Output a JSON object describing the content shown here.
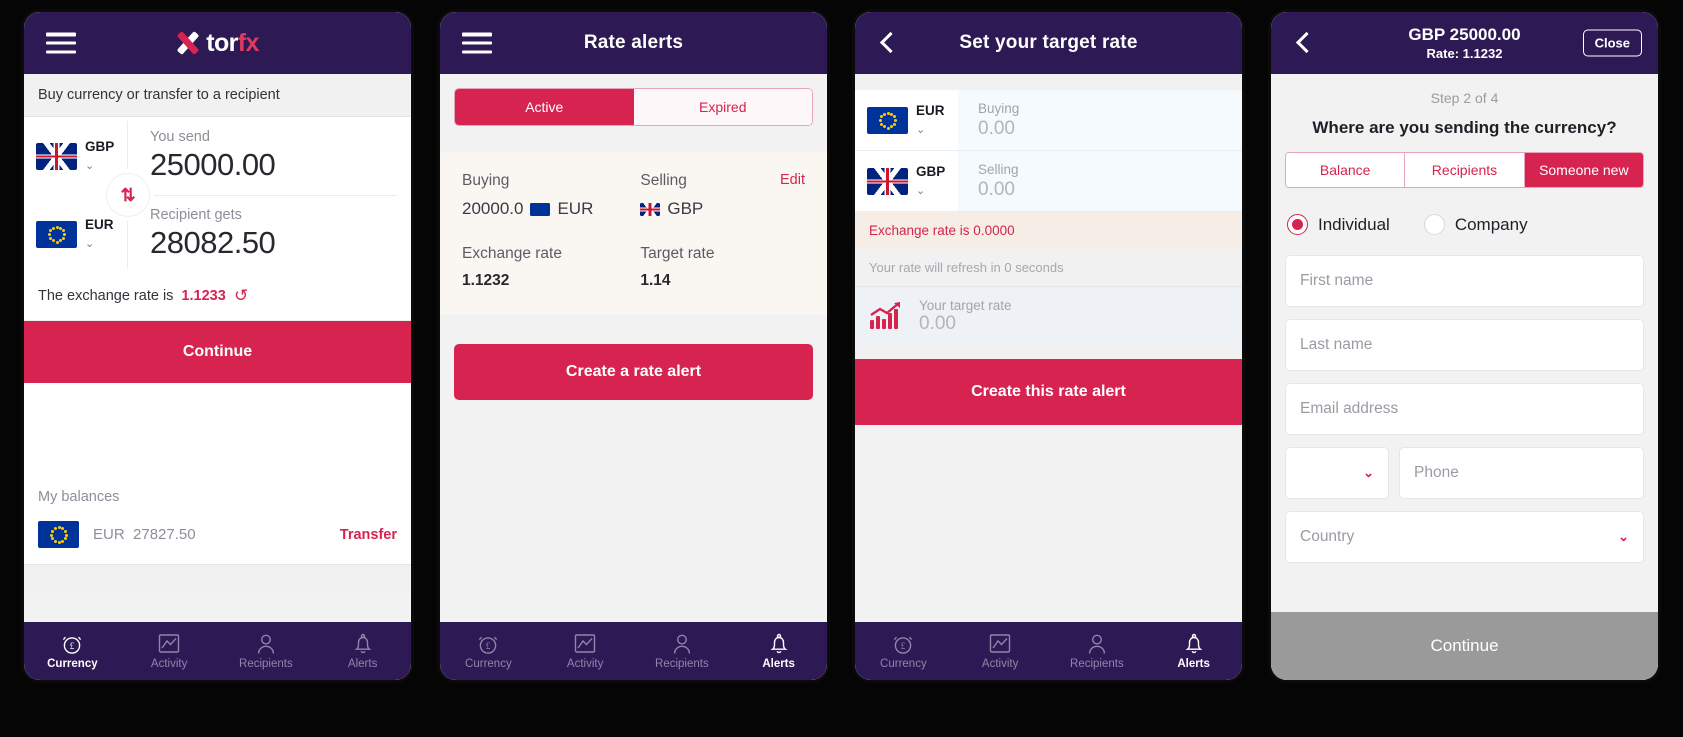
{
  "nav": {
    "items": [
      {
        "label": "Currency",
        "icon": "alarm-pound-icon"
      },
      {
        "label": "Activity",
        "icon": "chart-frame-icon"
      },
      {
        "label": "Recipients",
        "icon": "person-icon"
      },
      {
        "label": "Alerts",
        "icon": "bell-icon"
      }
    ]
  },
  "phone1": {
    "logo": {
      "tor": "tor",
      "fx": "fx"
    },
    "subtitle": "Buy currency or transfer to a recipient",
    "send": {
      "currency": "GBP",
      "label": "You send",
      "value": "25000.00",
      "flag": "gb"
    },
    "receive": {
      "currency": "EUR",
      "label": "Recipient gets",
      "value": "28082.50",
      "flag": "eu"
    },
    "swap_icon": "⇅",
    "rate_text": "The exchange rate is",
    "rate_value": "1.1233",
    "continue": "Continue",
    "balances_title": "My balances",
    "balance": {
      "currency": "EUR",
      "amount": "27827.50",
      "action": "Transfer"
    },
    "active_nav": 0
  },
  "phone2": {
    "title": "Rate alerts",
    "tabs": [
      {
        "label": "Active",
        "active": true
      },
      {
        "label": "Expired",
        "active": false
      }
    ],
    "alert": {
      "buying_label": "Buying",
      "buying_amount": "20000.0",
      "buying_currency": "EUR",
      "selling_label": "Selling",
      "selling_currency": "GBP",
      "edit": "Edit",
      "exchange_rate_label": "Exchange rate",
      "exchange_rate_value": "1.1232",
      "target_rate_label": "Target rate",
      "target_rate_value": "1.14"
    },
    "cta": "Create a rate alert",
    "active_nav": 3
  },
  "phone3": {
    "title": "Set your target rate",
    "buy": {
      "currency": "EUR",
      "label": "Buying",
      "value": "0.00",
      "flag": "eu"
    },
    "sell": {
      "currency": "GBP",
      "label": "Selling",
      "value": "0.00",
      "flag": "gb"
    },
    "error": "Exchange rate is 0.0000",
    "refresh_note": "Your rate will refresh in 0 seconds",
    "target": {
      "label": "Your target rate",
      "value": "0.00"
    },
    "cta": "Create this rate alert",
    "active_nav": 3
  },
  "phone4": {
    "header_amount": "GBP 25000.00",
    "header_rate": "Rate: 1.1232",
    "close": "Close",
    "step": "Step 2 of 4",
    "question": "Where are you sending the currency?",
    "tabs": [
      {
        "label": "Balance",
        "active": false
      },
      {
        "label": "Recipients",
        "active": false
      },
      {
        "label": "Someone new",
        "active": true
      }
    ],
    "radios": [
      {
        "label": "Individual",
        "selected": true
      },
      {
        "label": "Company",
        "selected": false
      }
    ],
    "fields": {
      "first_name": "First name",
      "last_name": "Last name",
      "email": "Email address",
      "dial_code": "",
      "phone": "Phone",
      "country": "Country"
    },
    "cta": "Continue"
  },
  "colors": {
    "brand": "#d6234f",
    "header": "#2d1a55",
    "nav_inactive": "#8d86a8"
  }
}
